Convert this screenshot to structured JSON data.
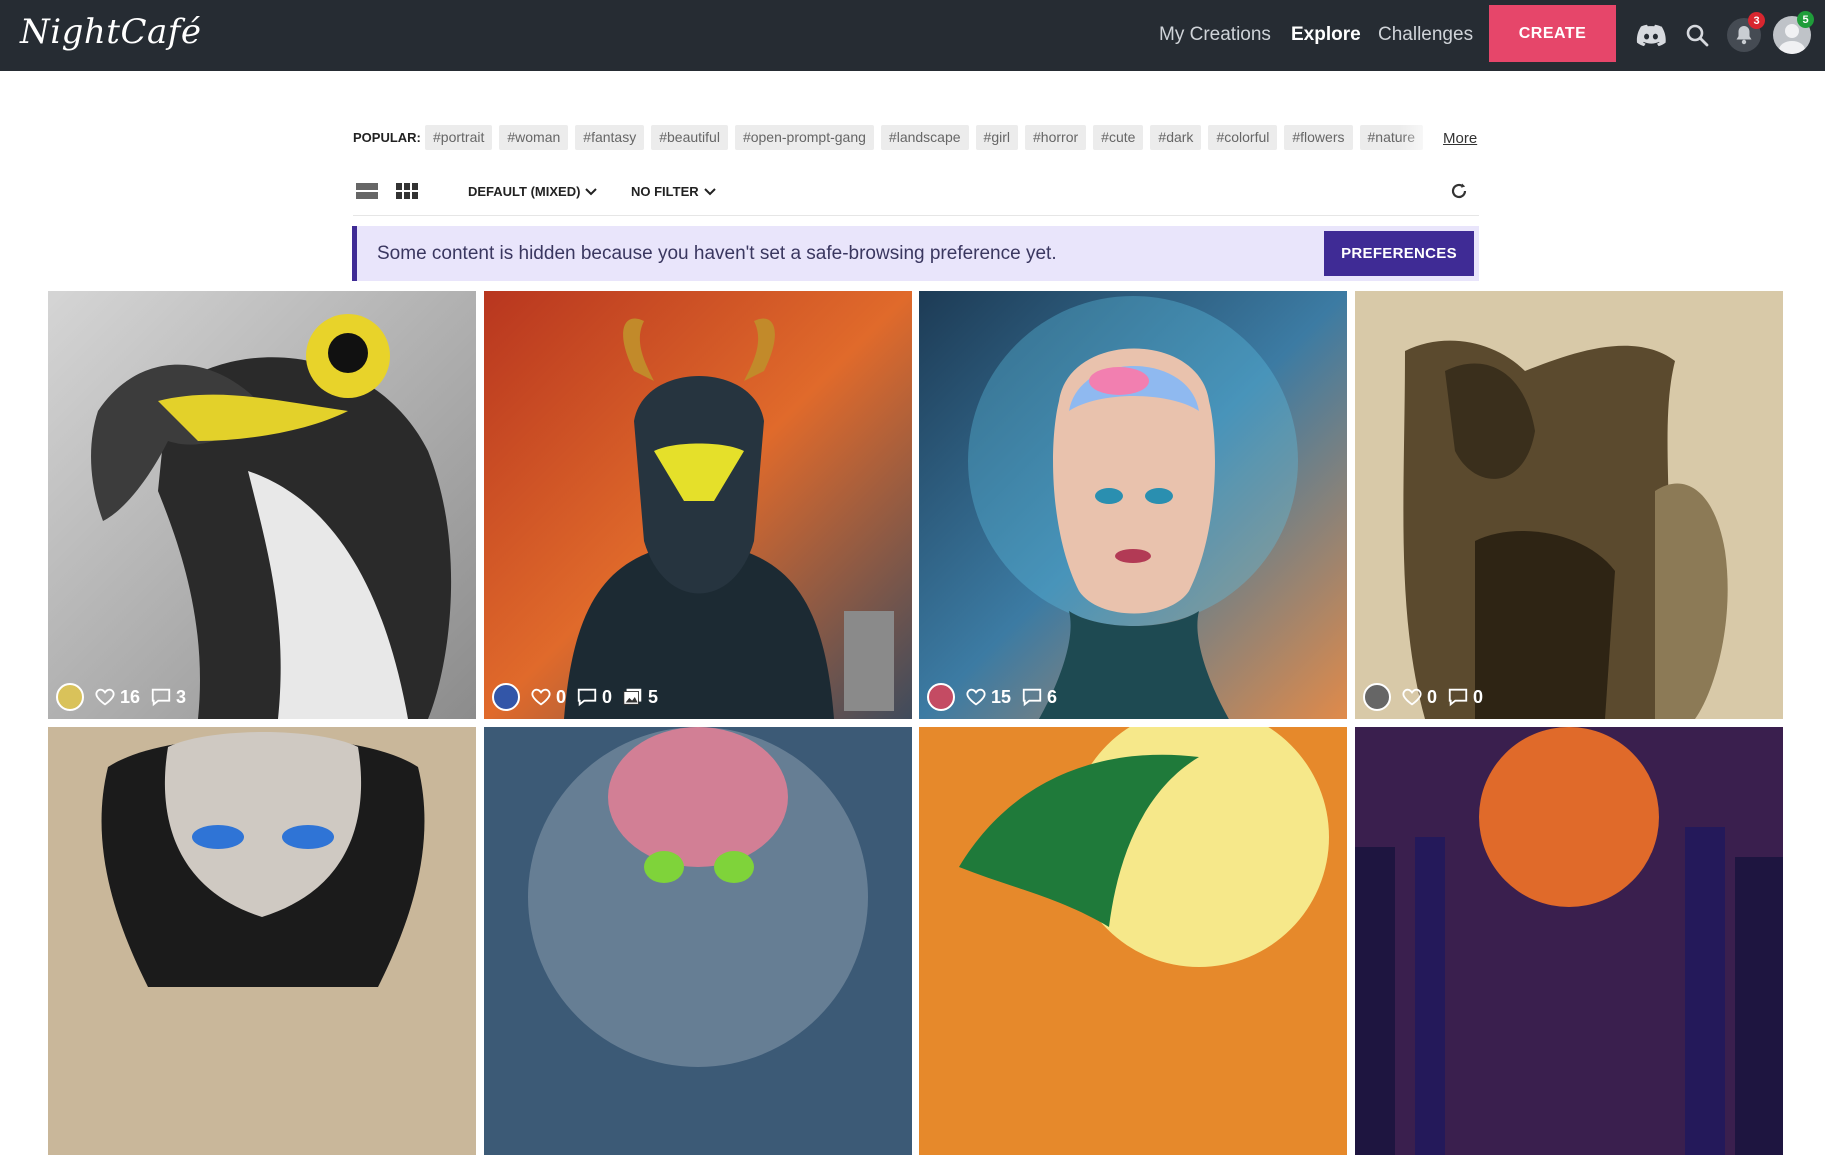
{
  "app": {
    "logo": "NightCafé"
  },
  "header": {
    "nav": [
      {
        "label": "My Creations"
      },
      {
        "label": "Explore"
      },
      {
        "label": "Challenges"
      }
    ],
    "create_label": "CREATE",
    "notification_count": "3",
    "avatar_count": "5"
  },
  "popular": {
    "label": "POPULAR:",
    "tags": [
      "#portrait",
      "#woman",
      "#fantasy",
      "#beautiful",
      "#open-prompt-gang",
      "#landscape",
      "#girl",
      "#horror",
      "#cute",
      "#dark",
      "#colorful",
      "#flowers",
      "#nature"
    ],
    "more_label": "More"
  },
  "toolbar": {
    "sort_label": "DEFAULT (MIXED)",
    "filter_label": "NO FILTER"
  },
  "notice": {
    "text": "Some content is hidden because you haven't set a safe-browsing preference yet.",
    "button_label": "PREFERENCES"
  },
  "grid": [
    {
      "likes": "16",
      "comments": "3"
    },
    {
      "likes": "0",
      "comments": "0",
      "images": "5"
    },
    {
      "likes": "15",
      "comments": "6"
    },
    {
      "likes": "0",
      "comments": "0"
    }
  ],
  "colors": {
    "header_bg": "#262c33",
    "create": "#e6466a",
    "accent": "#3f2b95",
    "notice_bg": "#e9e5fb"
  }
}
